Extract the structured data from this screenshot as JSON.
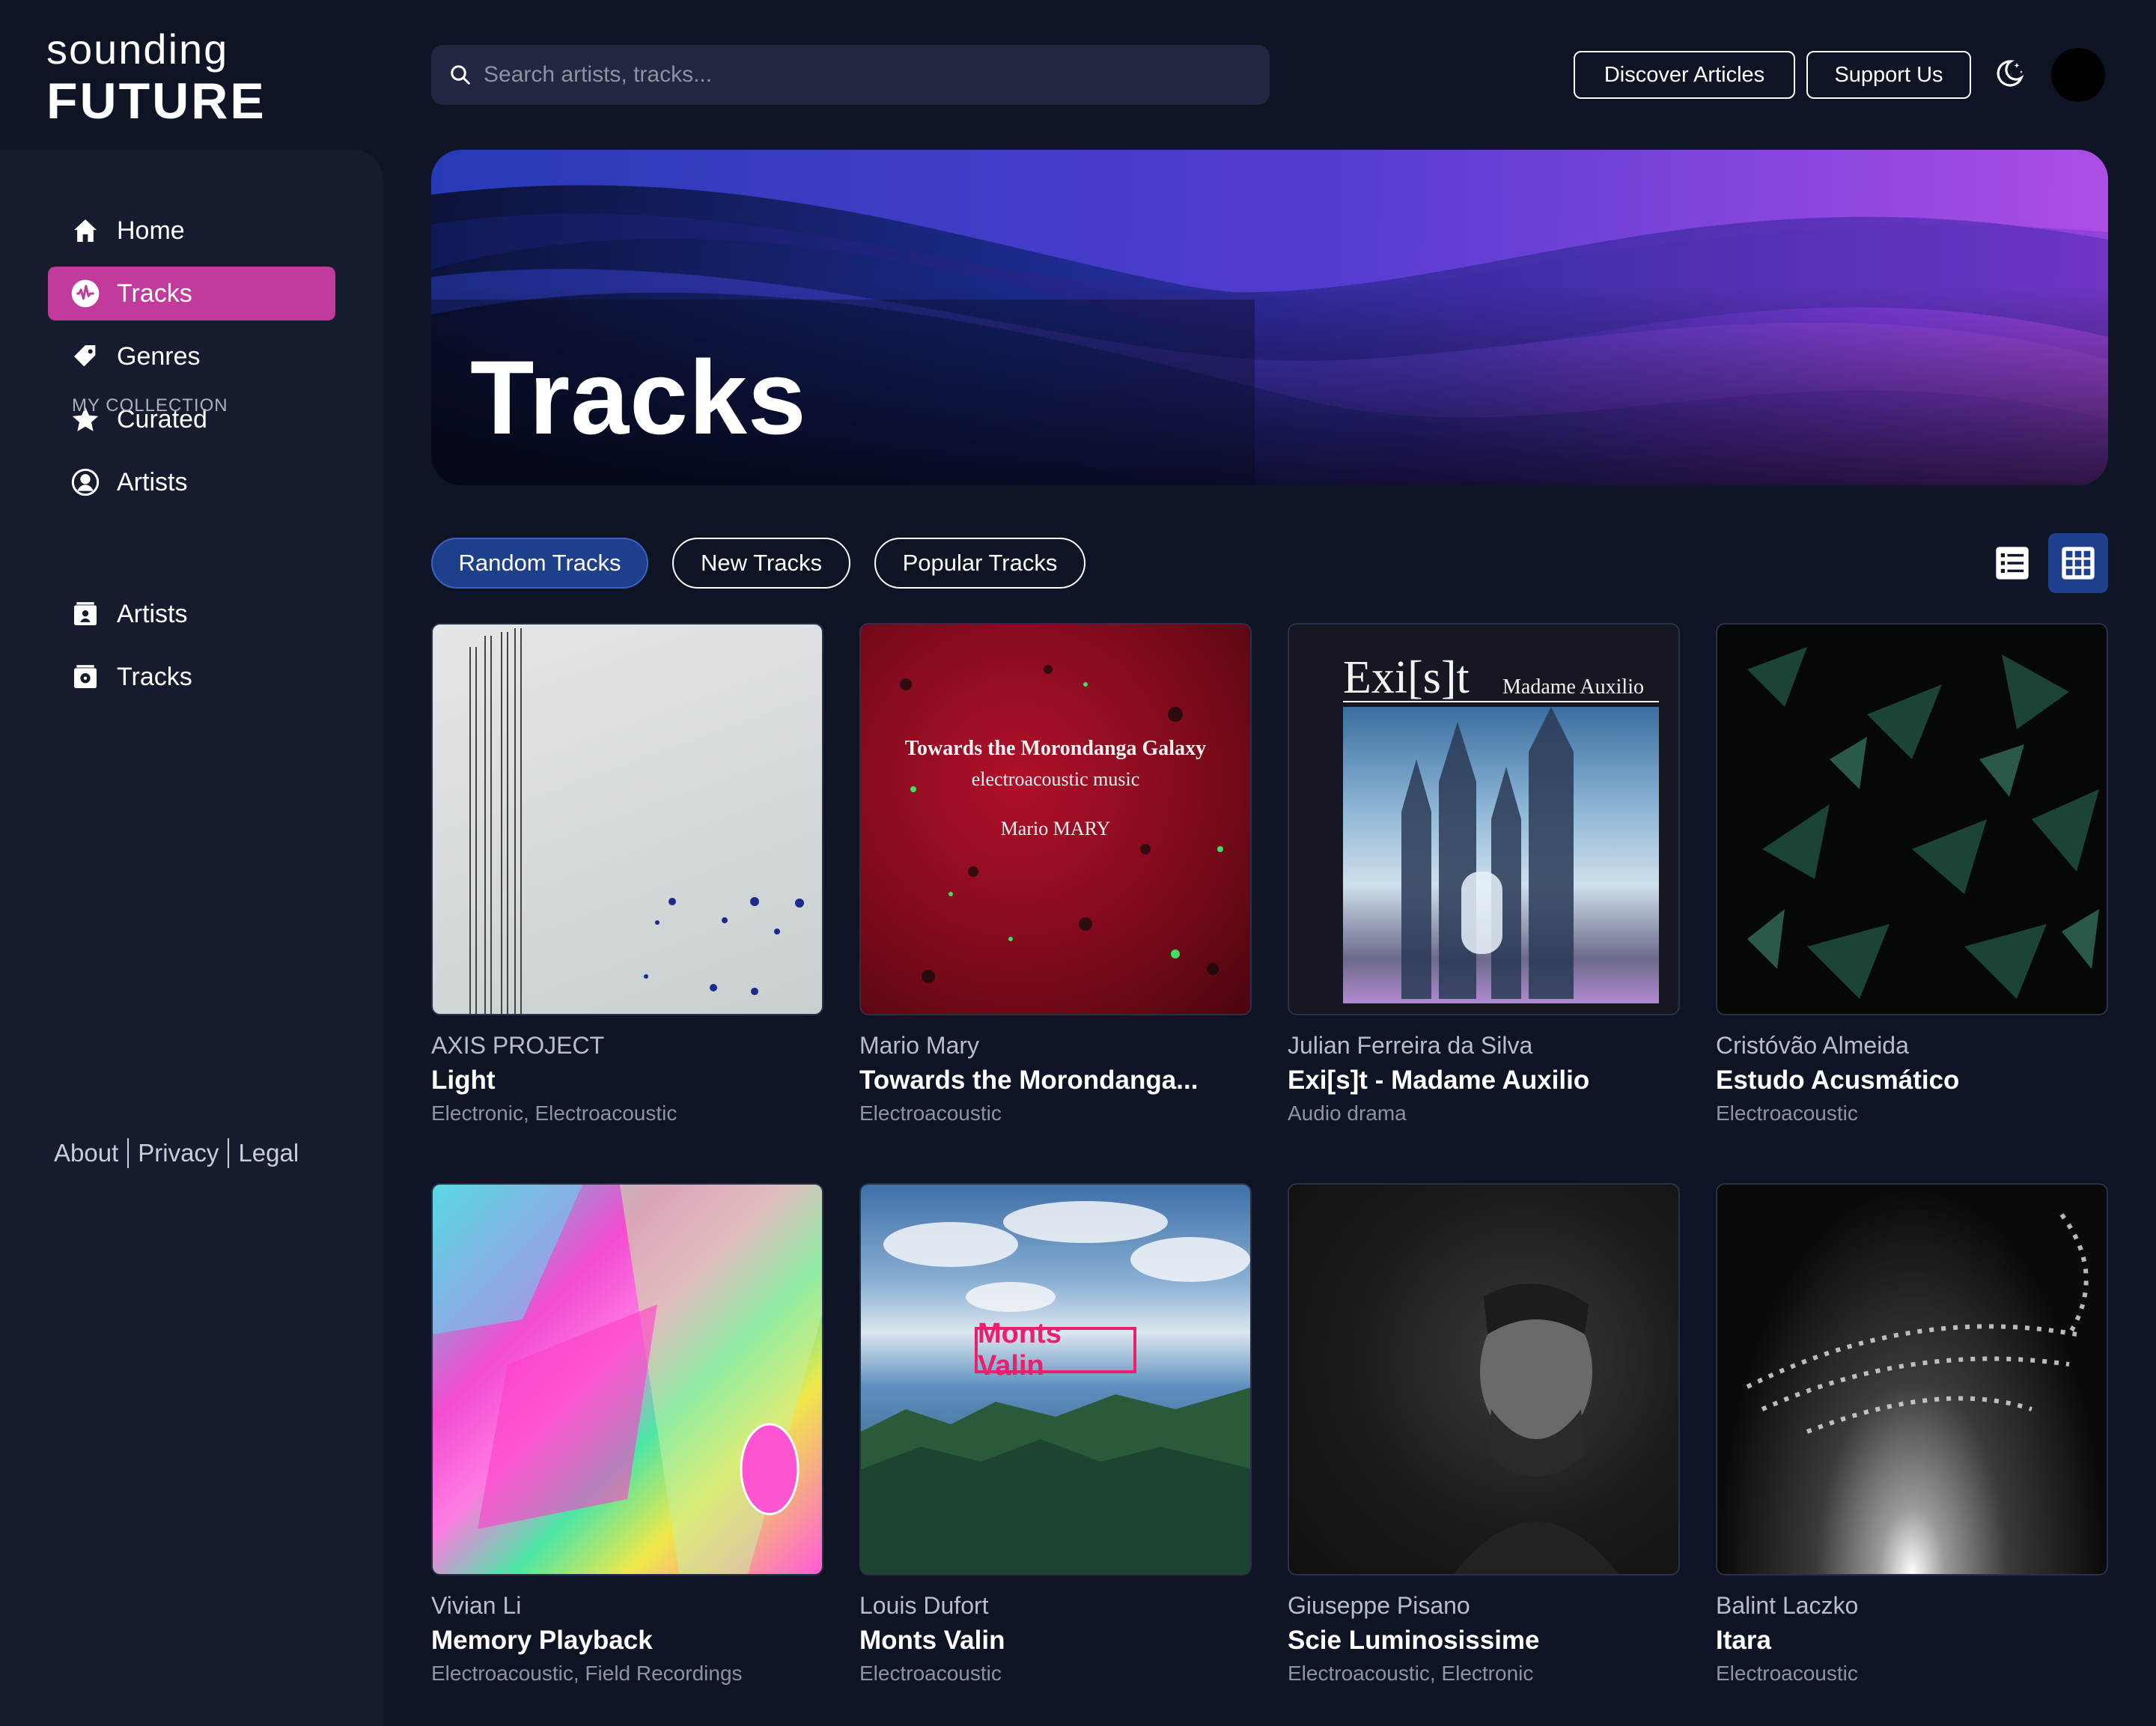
{
  "brand": {
    "line1": "sounding",
    "line2": "FUTURE"
  },
  "search": {
    "placeholder": "Search artists, tracks..."
  },
  "header": {
    "discover_label": "Discover Articles",
    "support_label": "Support Us"
  },
  "sidebar": {
    "items": [
      {
        "label": "Home",
        "icon": "home-icon"
      },
      {
        "label": "Tracks",
        "icon": "waveform-icon",
        "active": true
      },
      {
        "label": "Genres",
        "icon": "tag-icon"
      },
      {
        "label": "Curated",
        "icon": "star-icon"
      },
      {
        "label": "Artists",
        "icon": "user-circle-icon"
      }
    ],
    "collection_label": "MY COLLECTION",
    "collection_items": [
      {
        "label": "Artists",
        "icon": "collection-artists-icon"
      },
      {
        "label": "Tracks",
        "icon": "collection-tracks-icon"
      }
    ],
    "footer": {
      "about": "About",
      "privacy": "Privacy",
      "legal": "Legal"
    }
  },
  "hero": {
    "title": "Tracks"
  },
  "tabs": [
    {
      "label": "Random Tracks",
      "active": true
    },
    {
      "label": "New Tracks"
    },
    {
      "label": "Popular Tracks"
    }
  ],
  "view": {
    "mode": "grid"
  },
  "tracks": [
    {
      "artist": "AXIS PROJECT",
      "title": "Light",
      "genres": "Electronic, Electroacoustic"
    },
    {
      "artist": "Mario Mary",
      "title": "Towards the Morondanga...",
      "genres": "Electroacoustic",
      "cover_text": {
        "line1": "Towards the Morondanga Galaxy",
        "line2": "electroacoustic music",
        "line3": "Mario MARY"
      }
    },
    {
      "artist": "Julian Ferreira da Silva",
      "title": "Exi[s]t - Madame Auxilio",
      "genres": "Audio drama",
      "cover_text": {
        "big": "Exi[s]t",
        "small": "Madame Auxilio"
      }
    },
    {
      "artist": "Cristóvão Almeida",
      "title": "Estudo Acusmático",
      "genres": "Electroacoustic"
    },
    {
      "artist": "Vivian Li",
      "title": "Memory Playback",
      "genres": "Electroacoustic, Field Recordings"
    },
    {
      "artist": "Louis Dufort",
      "title": "Monts Valin",
      "genres": "Electroacoustic",
      "cover_text": {
        "label": "Monts Valin"
      }
    },
    {
      "artist": "Giuseppe Pisano",
      "title": "Scie Luminosissime",
      "genres": "Electroacoustic, Electronic"
    },
    {
      "artist": "Balint Laczko",
      "title": "Itara",
      "genres": "Electroacoustic"
    }
  ],
  "colors": {
    "background": "#0f1424",
    "sidebar": "#161c2d",
    "accent": "#c03b9c",
    "tab_active": "#1e3f8c"
  }
}
